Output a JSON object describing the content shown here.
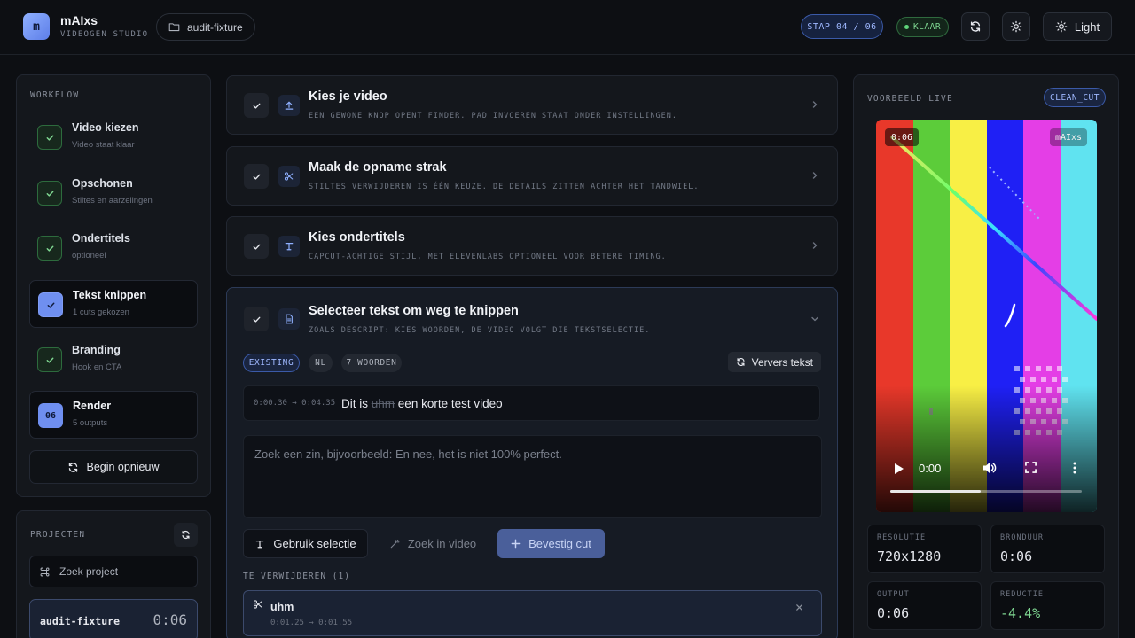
{
  "header": {
    "logo_letter": "m",
    "brand_name": "mAIxs",
    "brand_sub": "VIDEOGEN STUDIO",
    "project_pill": "audit-fixture",
    "step_badge": "STAP 04 / 06",
    "status_badge": "KLAAR",
    "theme_button": "Light"
  },
  "workflow": {
    "label": "WORKFLOW",
    "items": [
      {
        "title": "Video kiezen",
        "sub": "Video staat klaar",
        "state": "done"
      },
      {
        "title": "Opschonen",
        "sub": "Stiltes en aarzelingen",
        "state": "done"
      },
      {
        "title": "Ondertitels",
        "sub": "optioneel",
        "state": "done"
      },
      {
        "title": "Tekst knippen",
        "sub": "1 cuts gekozen",
        "state": "active"
      },
      {
        "title": "Branding",
        "sub": "Hook en CTA",
        "state": "done"
      },
      {
        "title": "Render",
        "sub": "5 outputs",
        "state": "number",
        "number": "06"
      }
    ],
    "restart_button": "Begin opnieuw"
  },
  "projects": {
    "label": "PROJECTEN",
    "search_placeholder": "Zoek project",
    "items": [
      {
        "name": "audit-fixture",
        "duration": "0:06"
      }
    ]
  },
  "steps": [
    {
      "title": "Kies je video",
      "sub": "EEN GEWONE KNOP OPENT FINDER. PAD INVOEREN STAAT ONDER INSTELLINGEN."
    },
    {
      "title": "Maak de opname strak",
      "sub": "STILTES VERWIJDEREN IS ÉÉN KEUZE. DE DETAILS ZITTEN ACHTER HET TANDWIEL."
    },
    {
      "title": "Kies ondertitels",
      "sub": "CAPCUT-ACHTIGE STIJL, MET ELEVENLABS OPTIONEEL VOOR BETERE TIMING."
    }
  ],
  "active_step": {
    "title": "Selecteer tekst om weg te knippen",
    "sub": "ZOALS DESCRIPT: KIES WOORDEN, DE VIDEO VOLGT DIE TEKSTSELECTIE.",
    "chips": {
      "source": "EXISTING",
      "language": "NL",
      "words": "7 WOORDEN"
    },
    "refresh_button": "Ververs tekst",
    "transcript": {
      "time": "0:00.30 → 0:04.35",
      "before": "Dit is",
      "struck": "uhm",
      "after": "een korte test video"
    },
    "search_placeholder": "Zoek een zin, bijvoorbeeld: En nee, het is niet 100% perfect.",
    "search_value": "",
    "buttons": {
      "use_selection": "Gebruik selectie",
      "find_in_video": "Zoek in video",
      "confirm_cut": "Bevestig cut"
    },
    "remove_label": "TE VERWIJDEREN (1)",
    "removals": [
      {
        "word": "uhm",
        "time": "0:01.25 → 0:01.55"
      }
    ]
  },
  "preview": {
    "label": "VOORBEELD LIVE",
    "mode_chip": "CLEAN_CUT",
    "overlay_time": "0:06",
    "overlay_logo": "mAIxs",
    "current_time": "0:00",
    "progress_fraction": 0.47,
    "bar_colors": [
      "#e8382a",
      "#5ccc3a",
      "#f8ef45",
      "#1f20f5",
      "#e43ee6",
      "#60e3f0"
    ],
    "stats": [
      {
        "label": "RESOLUTIE",
        "value": "720x1280"
      },
      {
        "label": "BRONDUUR",
        "value": "0:06"
      },
      {
        "label": "OUTPUT",
        "value": "0:06"
      },
      {
        "label": "REDUCTIE",
        "value": "-4.4%"
      }
    ]
  },
  "colors": {
    "accent": "#6f8ff0",
    "success": "#5fd47a",
    "background": "#0d0f13"
  }
}
